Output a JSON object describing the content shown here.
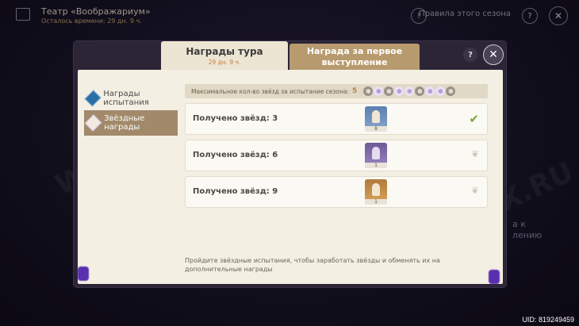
{
  "background": {
    "title": "Театр «Воображариум»",
    "subtitle": "Осталось времени: 29 дн. 9 ч.",
    "rules_link": "Правила этого сезона",
    "help_glyph": "?",
    "right_side_text": "а к",
    "right_side_text2": "лению",
    "watermark": "WUTHRIX.RU"
  },
  "dialog": {
    "tabs": [
      {
        "label": "Награды тура",
        "sub": "29 дн. 9 ч."
      },
      {
        "label": "Награда за первое выступление"
      }
    ],
    "help_glyph": "?",
    "close_glyph": "✕"
  },
  "sidebar": {
    "items": [
      {
        "label": "Награды испытания",
        "icon": "blue-diamond-icon"
      },
      {
        "label": "Звёздные награды",
        "icon": "star-badge-icon"
      }
    ]
  },
  "content": {
    "max_stars_label": "Максимальное кол-во звёзд за испытание сезона:",
    "max_stars_value": "5",
    "stars": [
      {
        "state": "grey"
      },
      {
        "state": "purple"
      },
      {
        "state": "grey"
      },
      {
        "state": "purple"
      },
      {
        "state": "purple"
      },
      {
        "state": "grey"
      },
      {
        "state": "purple"
      },
      {
        "state": "purple"
      },
      {
        "state": "grey"
      }
    ],
    "rows": [
      {
        "label": "Получено звёзд: 3",
        "item_count": "8",
        "status": "claimed",
        "status_glyph": "✔"
      },
      {
        "label": "Получено звёзд: 6",
        "item_count": "1",
        "status": "locked",
        "status_glyph": "❦"
      },
      {
        "label": "Получено звёзд: 9",
        "item_count": "1",
        "status": "locked",
        "status_glyph": "❦"
      }
    ],
    "footer": "Пройдите звёздные испытания, чтобы заработать звёзды и обменять их на дополнительные награды"
  },
  "uid": "UID: 819249459",
  "colors": {
    "accent": "#c0813d",
    "tab_active": "#ece5d4",
    "tab_inactive": "#b89a6f",
    "check": "#7aa63a"
  }
}
